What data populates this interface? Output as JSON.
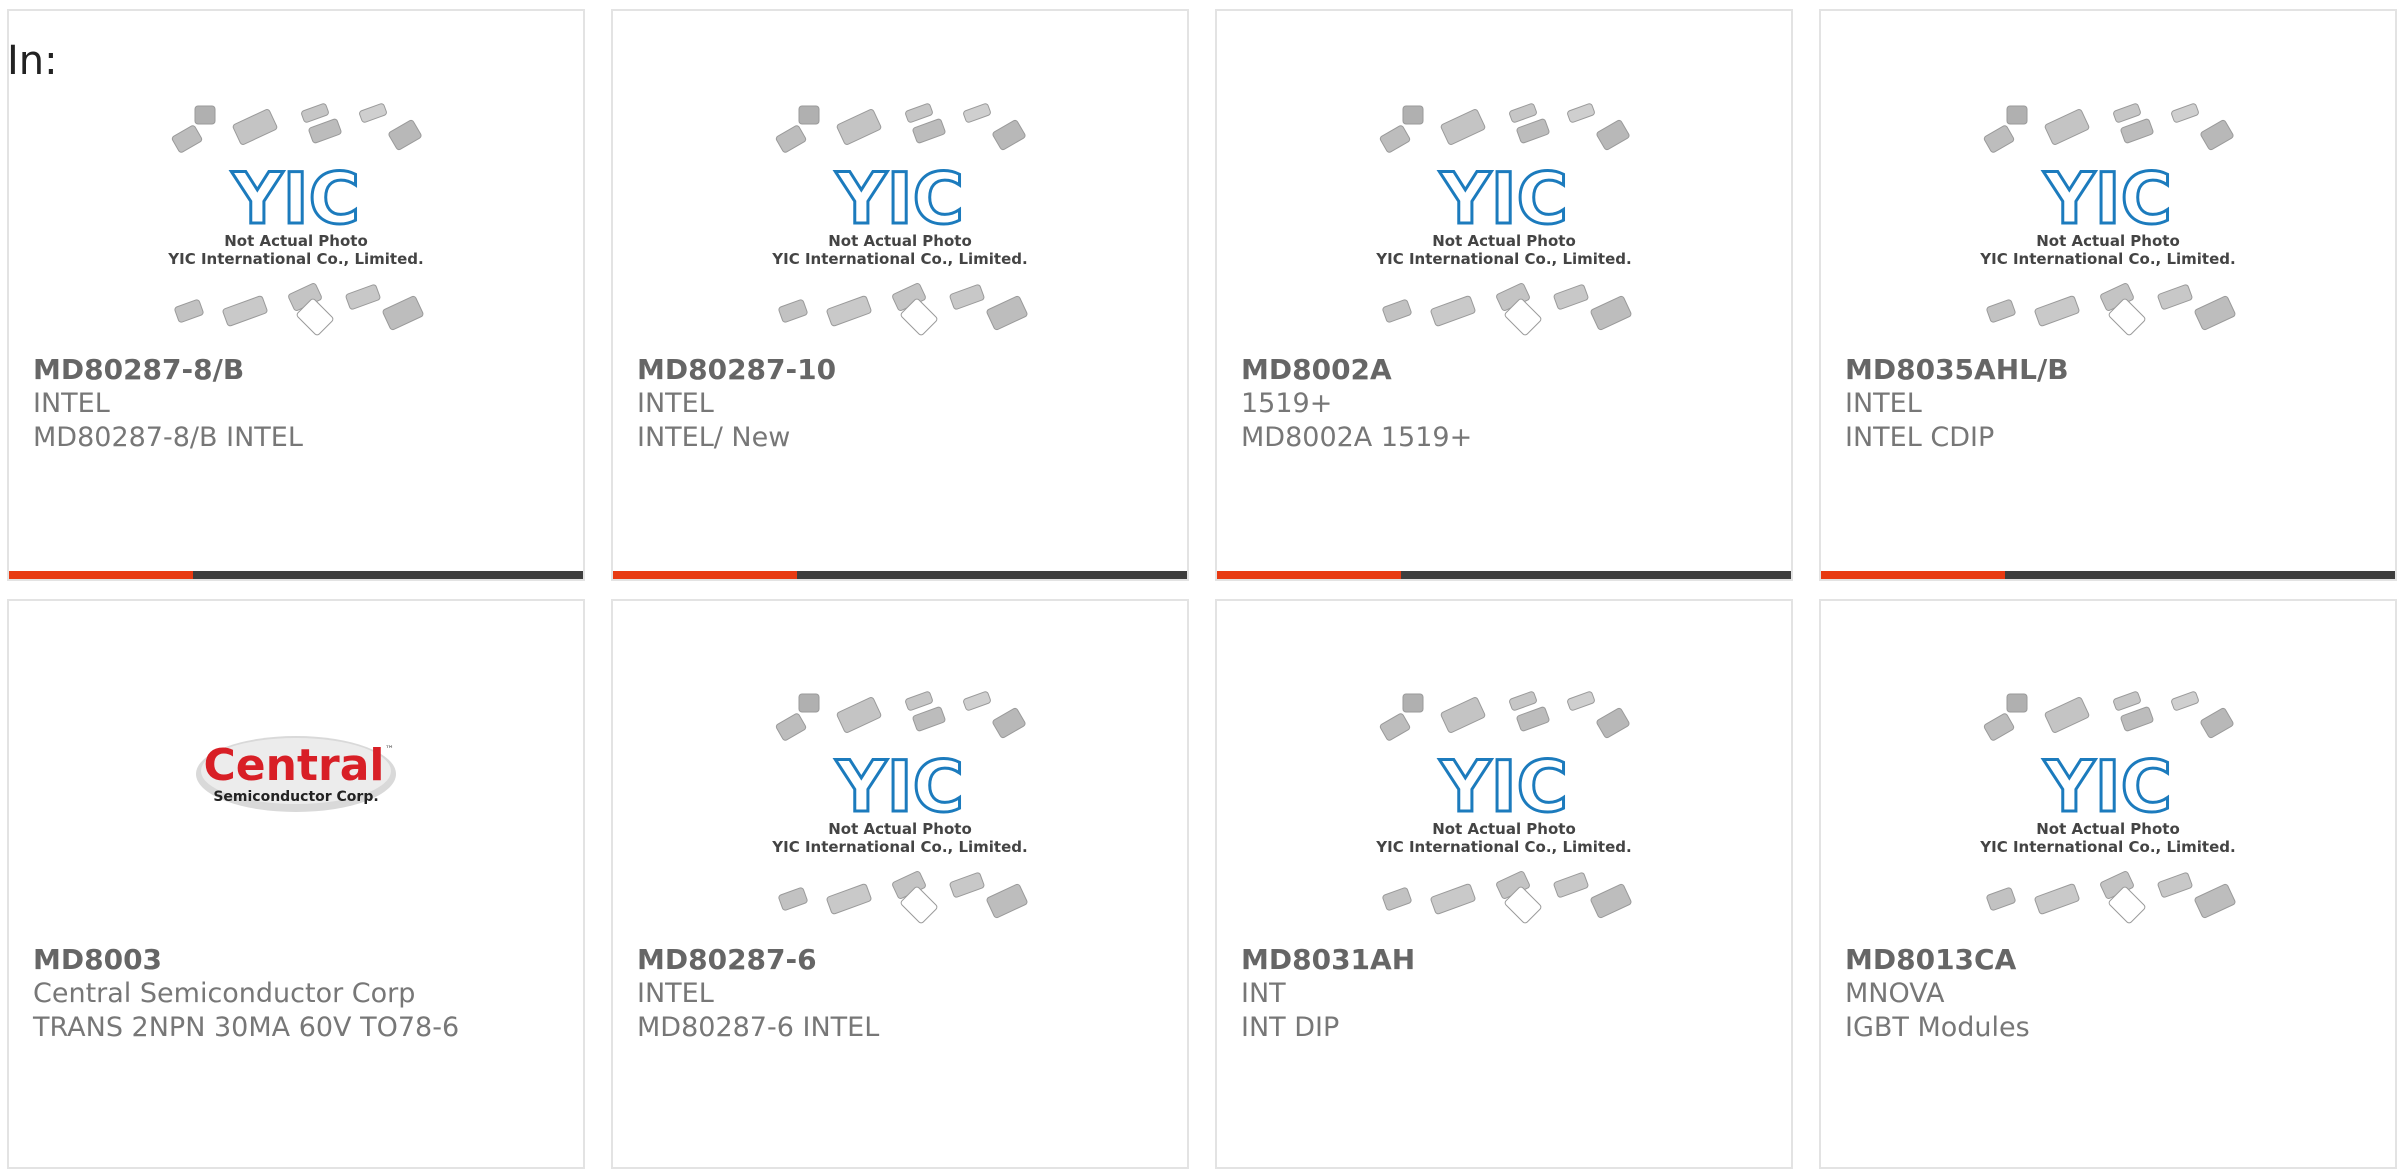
{
  "page": {
    "in_label": "In:"
  },
  "theme": {
    "accent": "#e83a12",
    "bar_track": "#3d3d3d",
    "yic_blue": "#1c7bbd",
    "central_red": "#d81f26"
  },
  "placeholder_photo": {
    "logo": "YIC",
    "line1": "Not Actual Photo",
    "line2": "YIC International Co., Limited."
  },
  "central_logo": {
    "name": "Central",
    "tm": "™",
    "tagline": "Semiconductor Corp."
  },
  "cards": [
    {
      "part_number": "MD80287-8/B",
      "manufacturer": "INTEL",
      "description": "MD80287-8/B INTEL",
      "image": "yic-placeholder",
      "progress": 0.32
    },
    {
      "part_number": "MD80287-10",
      "manufacturer": "INTEL",
      "description": "INTEL/ New",
      "image": "yic-placeholder",
      "progress": 0.32
    },
    {
      "part_number": "MD8002A",
      "manufacturer": "1519+",
      "description": "MD8002A 1519+",
      "image": "yic-placeholder",
      "progress": 0.32
    },
    {
      "part_number": "MD8035AHL/B",
      "manufacturer": "INTEL",
      "description": "INTEL CDIP",
      "image": "yic-placeholder",
      "progress": 0.32
    },
    {
      "part_number": "MD8003",
      "manufacturer": "Central Semiconductor Corp",
      "description": "TRANS 2NPN 30MA 60V TO78-6",
      "image": "central-logo"
    },
    {
      "part_number": "MD80287-6",
      "manufacturer": "INTEL",
      "description": "MD80287-6 INTEL",
      "image": "yic-placeholder"
    },
    {
      "part_number": "MD8031AH",
      "manufacturer": "INT",
      "description": "INT DIP",
      "image": "yic-placeholder"
    },
    {
      "part_number": "MD8013CA",
      "manufacturer": "MNOVA",
      "description": "IGBT Modules",
      "image": "yic-placeholder"
    }
  ]
}
